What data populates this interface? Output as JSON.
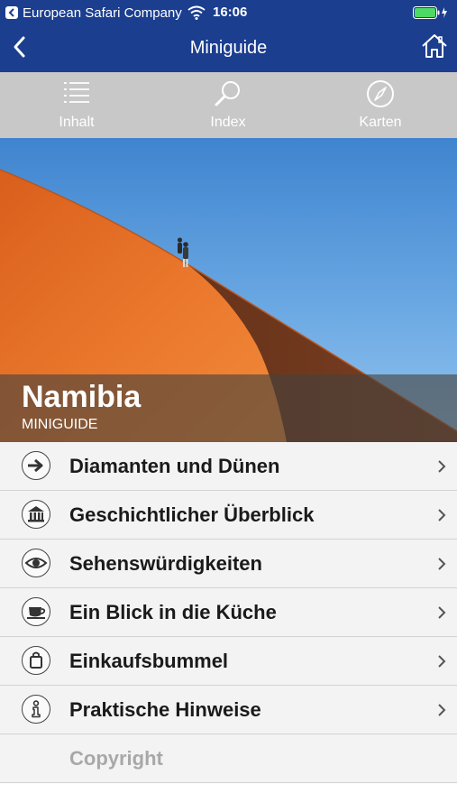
{
  "statusbar": {
    "carrier": "European Safari Company",
    "time": "16:06",
    "battery_color": "#4cd964"
  },
  "navbar": {
    "title": "Miniguide",
    "back_icon": "chevron-left-icon",
    "home_icon": "home-icon"
  },
  "toolbar": {
    "items": [
      {
        "label": "Inhalt",
        "icon": "list-icon"
      },
      {
        "label": "Index",
        "icon": "magnifier-icon"
      },
      {
        "label": "Karten",
        "icon": "compass-icon"
      }
    ]
  },
  "hero": {
    "title": "Namibia",
    "subtitle": "MINIGUIDE"
  },
  "menu": {
    "items": [
      {
        "label": "Diamanten und Dünen",
        "icon": "arrow-right-icon"
      },
      {
        "label": "Geschichtlicher Überblick",
        "icon": "museum-icon"
      },
      {
        "label": "Sehenswürdigkeiten",
        "icon": "eye-icon"
      },
      {
        "label": "Ein Blick in die Küche",
        "icon": "cup-icon"
      },
      {
        "label": "Einkaufsbummel",
        "icon": "shopping-bag-icon"
      },
      {
        "label": "Praktische Hinweise",
        "icon": "info-icon"
      }
    ],
    "copyright": "Copyright"
  },
  "colors": {
    "bar_blue": "#1b3e8f",
    "toolbar_gray": "#c8c8c8",
    "dune_orange": "#e8752c"
  }
}
